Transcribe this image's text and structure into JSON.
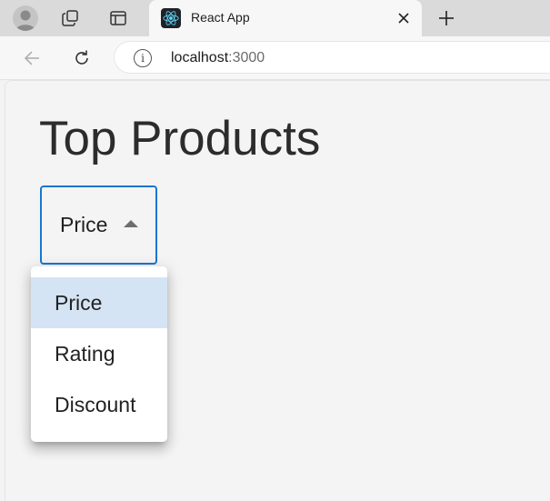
{
  "browser": {
    "tab": {
      "title": "React App",
      "favicon": "react-logo-icon"
    },
    "address": {
      "host": "localhost",
      "port": ":3000"
    },
    "icons": {
      "profile": "profile-avatar-icon",
      "workspaces": "workspaces-icon",
      "vertical_tabs": "tab-actions-icon",
      "close": "close-icon",
      "new_tab": "plus-icon",
      "back": "back-arrow-icon",
      "reload": "reload-icon",
      "info": "info-icon"
    }
  },
  "page": {
    "title": "Top Products",
    "sort_select": {
      "selected": "Price",
      "open": true,
      "options": [
        {
          "label": "Price",
          "selected": true
        },
        {
          "label": "Rating",
          "selected": false
        },
        {
          "label": "Discount",
          "selected": false
        }
      ]
    }
  },
  "colors": {
    "accent": "#1976d2",
    "selected_option_bg": "#d4e4f4",
    "page_bg": "#f4f4f4"
  }
}
